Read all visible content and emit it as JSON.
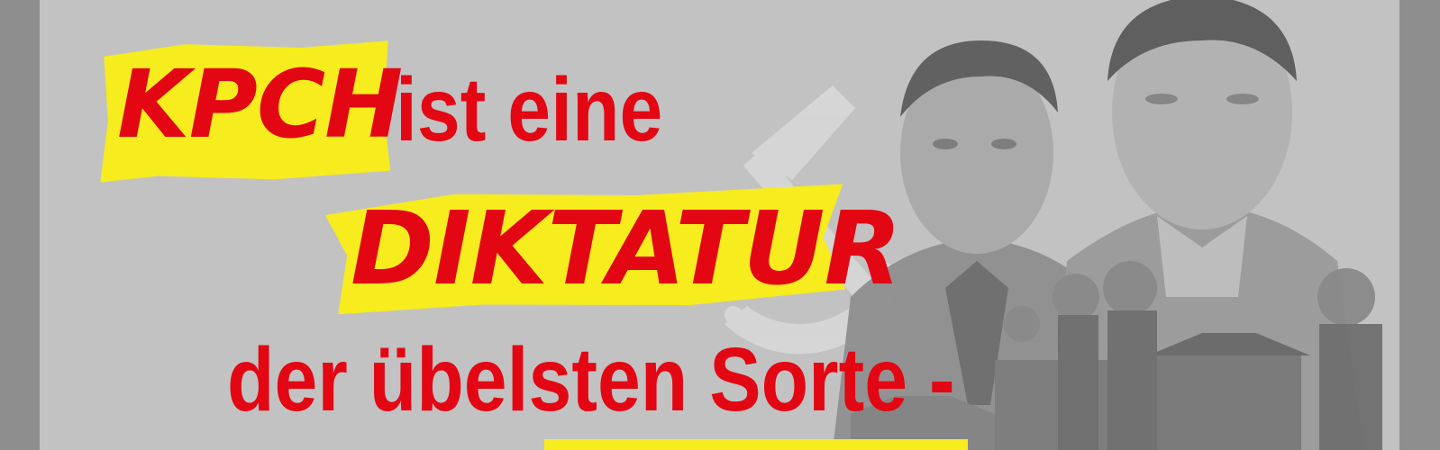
{
  "headline": {
    "line1_highlight": "KPCH",
    "line1_rest": "ist eine",
    "line2_highlight": "DIKTATUR",
    "line3": "der übelsten Sorte -"
  },
  "colors": {
    "text_red": "#e30613",
    "highlight_yellow": "#f7ec1e",
    "panel_gray": "#c2c2c2",
    "frame_gray": "#8e8e8e"
  },
  "imagery": {
    "background_symbol": "hammer-and-sickle",
    "portraits": [
      "portrait-left",
      "portrait-right"
    ],
    "scene": "soldiers-and-gate"
  }
}
